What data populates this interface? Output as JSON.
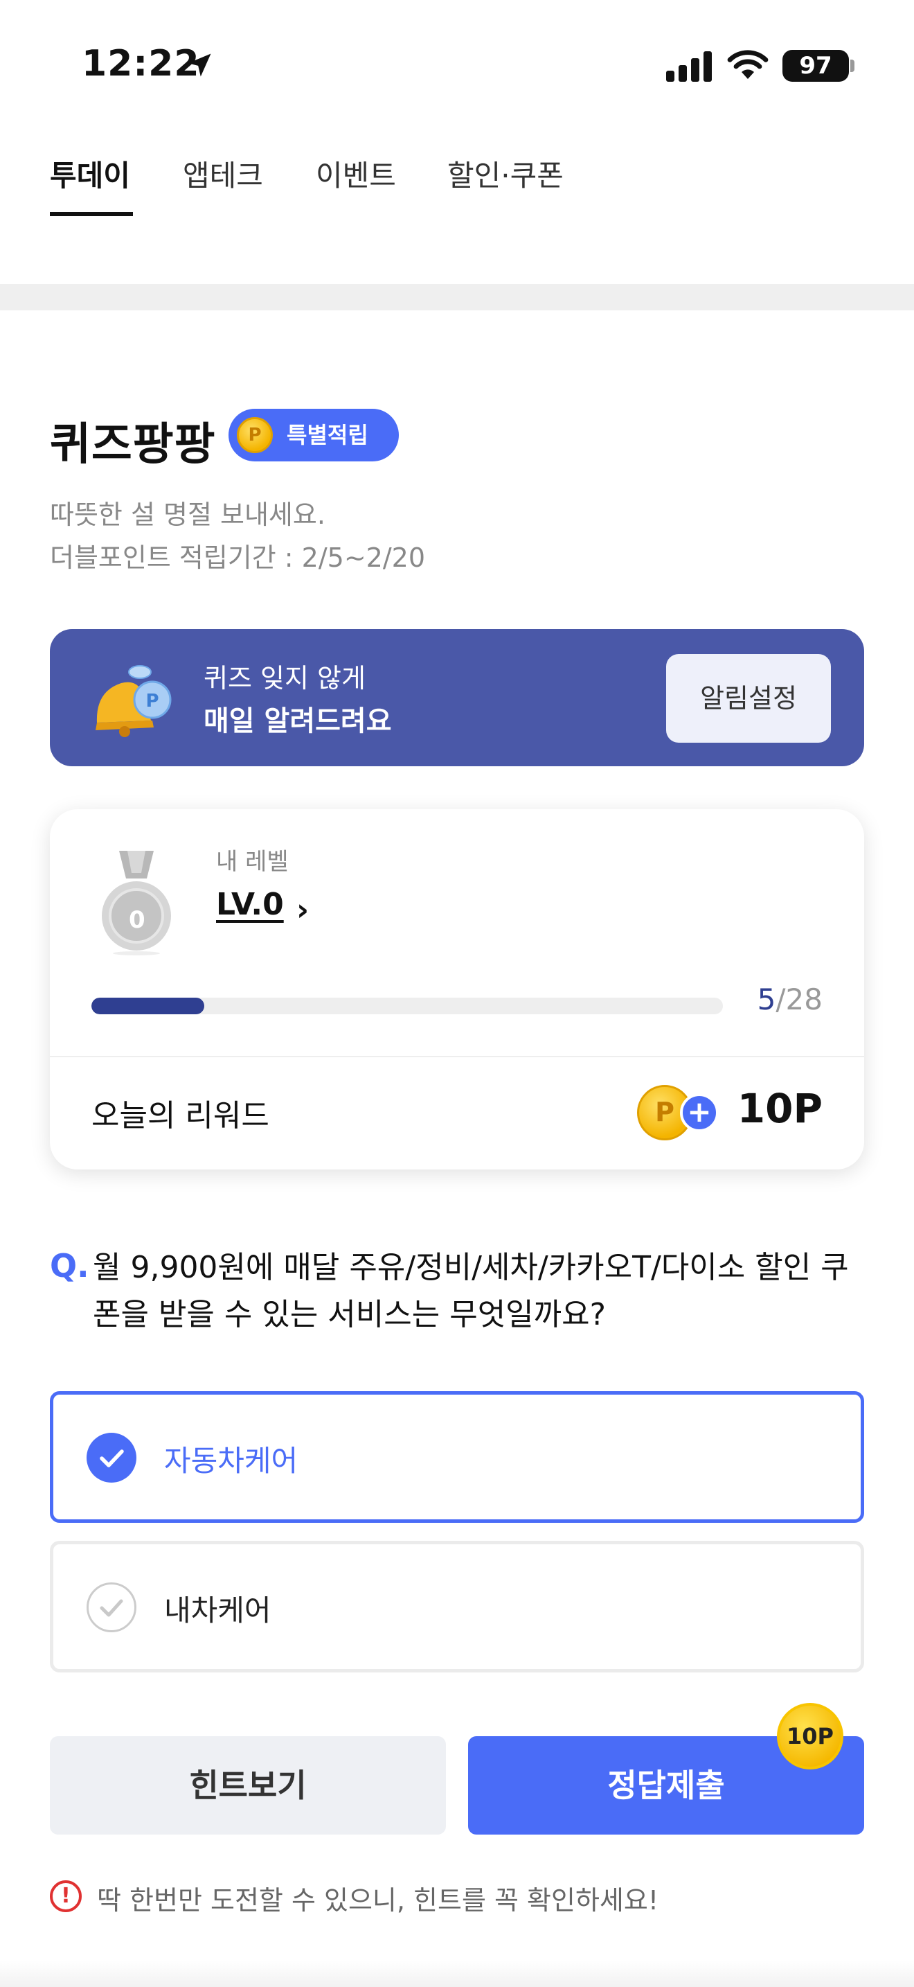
{
  "status_bar": {
    "time": "12:22",
    "battery": "97"
  },
  "tabs": [
    {
      "label": "투데이",
      "active": true
    },
    {
      "label": "앱테크",
      "active": false
    },
    {
      "label": "이벤트",
      "active": false
    },
    {
      "label": "할인·쿠폰",
      "active": false
    }
  ],
  "quiz": {
    "title": "퀴즈팡팡",
    "badge_label": "특별적립",
    "badge_coin": "P",
    "desc_line1": "따뜻한 설 명절 보내세요.",
    "desc_line2": "더블포인트 적립기간 : 2/5~2/20"
  },
  "notify": {
    "line1": "퀴즈 잊지 않게",
    "line2": "매일 알려드려요",
    "button_label": "알림설정"
  },
  "level": {
    "label": "내 레벨",
    "value": "LV.0",
    "medal_number": "0",
    "progress_current": "5",
    "progress_total": "/28",
    "progress_fraction": 0.1786,
    "reward_label": "오늘의 리워드",
    "reward_coin": "P",
    "reward_plus": "+",
    "reward_value": "10P"
  },
  "question": {
    "mark": "Q.",
    "text": "월 9,900원에 매달 주유/정비/세차/카카오T/다이소 할인 쿠폰을 받을 수 있는 서비스는 무엇일까요?"
  },
  "options": [
    {
      "label": "자동차케어",
      "selected": true
    },
    {
      "label": "내차케어",
      "selected": false
    }
  ],
  "buttons": {
    "hint": "힌트보기",
    "submit": "정답제출",
    "submit_badge": "10P"
  },
  "warning": {
    "icon": "!",
    "text": "딱 한번만 도전할 수 있으니, 힌트를 꼭 확인하세요!"
  },
  "colors": {
    "accent": "#4a6cf7",
    "banner": "#4a58a8",
    "progress": "#2f3f91",
    "warning": "#e03131"
  }
}
